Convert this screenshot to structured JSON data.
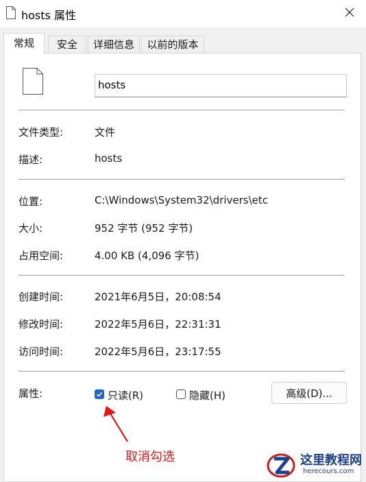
{
  "window": {
    "title": "hosts 属性",
    "close_icon": "close-icon"
  },
  "tabs": [
    {
      "label": "常规",
      "active": true
    },
    {
      "label": "安全",
      "active": false
    },
    {
      "label": "详细信息",
      "active": false
    },
    {
      "label": "以前的版本",
      "active": false
    }
  ],
  "general": {
    "file_name": "hosts",
    "rows": {
      "type": {
        "label": "文件类型:",
        "value": "文件"
      },
      "description": {
        "label": "描述:",
        "value": "hosts"
      },
      "location": {
        "label": "位置:",
        "value": "C:\\Windows\\System32\\drivers\\etc"
      },
      "size": {
        "label": "大小:",
        "value": "952 字节 (952 字节)"
      },
      "size_on_disk": {
        "label": "占用空间:",
        "value": "4.00 KB (4,096 字节)"
      },
      "created": {
        "label": "创建时间:",
        "value": "2021年6月5日，20:08:54"
      },
      "modified": {
        "label": "修改时间:",
        "value": "2022年5月6日，22:31:31"
      },
      "accessed": {
        "label": "访问时间:",
        "value": "2022年5月6日，23:17:55"
      }
    },
    "attributes": {
      "label": "属性:",
      "readonly": {
        "label": "只读(R)",
        "checked": true
      },
      "hidden": {
        "label": "隐藏(H)",
        "checked": false
      },
      "advanced_button": "高级(D)..."
    }
  },
  "annotation": {
    "text": "取消勾选",
    "color": "#e01818"
  },
  "watermark": {
    "name": "这里教程网",
    "url": "herecours.com"
  },
  "colors": {
    "checkbox_accent": "#1f64c6",
    "window_bg": "#f0f0f0",
    "panel_bg": "#ffffff"
  }
}
